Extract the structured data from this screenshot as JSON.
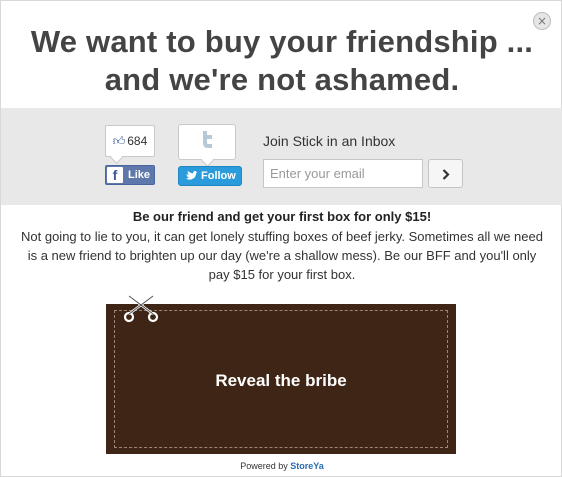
{
  "modal": {
    "close_label": "×",
    "headline_line1": "We want to buy your friendship ...",
    "headline_line2": "and we're not ashamed."
  },
  "social": {
    "like_count": "684",
    "like_label": "Like",
    "follow_label": "Follow"
  },
  "subscribe": {
    "label": "Join Stick in an Inbox",
    "email_placeholder": "Enter your email",
    "email_value": ""
  },
  "offer": {
    "title": "Be our friend and get your first box for only $15!",
    "body": "Not going to lie to you, it can get lonely stuffing boxes of beef jerky. Sometimes all we need is a new friend to brighten up our day (we're a shallow mess). Be our BFF and you'll only pay $15 for your first box."
  },
  "coupon": {
    "label": "Reveal the bribe"
  },
  "footer": {
    "powered_prefix": "Powered by",
    "brand": "StoreYa"
  },
  "icons": {
    "close": "close-icon",
    "thumbs_up": "thumbs-up-icon",
    "facebook": "facebook-icon",
    "twitter": "twitter-bird-icon",
    "submit": "chevron-right-icon",
    "scissors": "scissors-icon"
  },
  "colors": {
    "social_band": "#e8e8e8",
    "facebook_blue": "#5f78ab",
    "twitter_blue": "#2b9cdb",
    "coupon_brown": "#3e2515",
    "brand_link": "#2a6db2"
  }
}
